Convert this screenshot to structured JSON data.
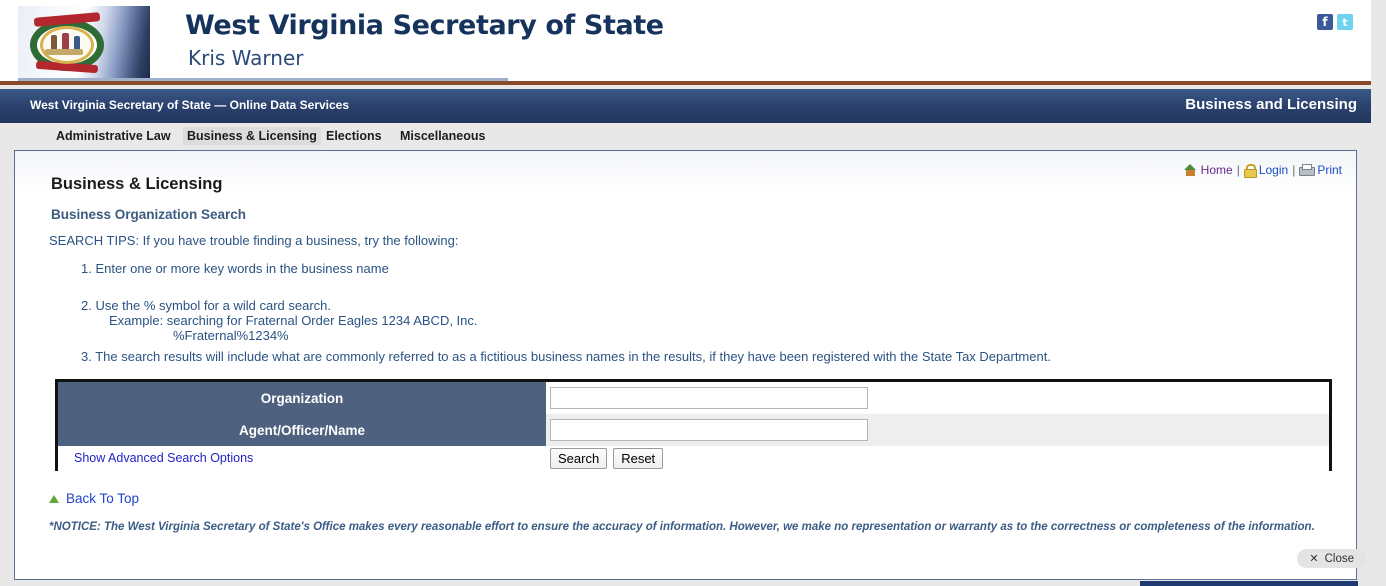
{
  "banner": {
    "title": "West Virginia Secretary of State",
    "subtitle": "Kris Warner",
    "flag_icon": "wv-state-flag-seal",
    "social": [
      {
        "name": "facebook-icon",
        "glyph": "f"
      },
      {
        "name": "twitter-icon",
        "glyph": "t"
      }
    ]
  },
  "navybar": {
    "left_title": "West Virginia Secretary of State — Online Data Services",
    "right_title": "Business and Licensing"
  },
  "menu": {
    "items": [
      {
        "label": "Administrative Law",
        "active": false
      },
      {
        "label": "Business & Licensing",
        "active": true
      },
      {
        "label": "Elections",
        "active": false
      },
      {
        "label": "Miscellaneous",
        "active": false
      }
    ]
  },
  "utility": {
    "home_label": "Home",
    "login_label": "Login",
    "print_label": "Print",
    "separator": "|",
    "home_icon": "home-icon",
    "login_icon": "lock-icon",
    "print_icon": "printer-icon"
  },
  "content": {
    "heading": "Business & Licensing",
    "subheading": "Business Organization Search",
    "tips_intro": "SEARCH TIPS: If you have trouble finding a business, try the following:",
    "tip1": "1. Enter one or more key words in the business name",
    "tip2": "2. Use the % symbol for a wild card search.",
    "tip2_example": "Example: searching for Fraternal Order Eagles 1234 ABCD, Inc.",
    "tip2_pattern": "%Fraternal%1234%",
    "tip3": "3. The search results will include what are commonly referred to as a fictitious business names in the results, if they have been registered with the State Tax Department."
  },
  "form": {
    "organization_label": "Organization",
    "organization_value": "",
    "organization_placeholder": "",
    "agent_label": "Agent/Officer/Name",
    "agent_value": "",
    "agent_placeholder": "",
    "advanced_link": "Show Advanced Search Options",
    "search_button": "Search",
    "reset_button": "Reset"
  },
  "footer": {
    "back_to_top": "Back To Top",
    "back_to_top_icon": "up-arrow-icon",
    "notice": "*NOTICE: The West Virginia Secretary of State's Office makes every reasonable effort to ensure the accuracy of information. However, we make no representation or warranty as to the correctness or completeness of the information."
  },
  "overlay": {
    "close_label": "Close",
    "close_icon": "close-x-icon"
  },
  "colors": {
    "navy": "#2c4370",
    "label_slate": "#4e6280",
    "accent_brown": "#8a4b2a",
    "link_blue": "#2244cc",
    "body_blue": "#2b5384"
  }
}
